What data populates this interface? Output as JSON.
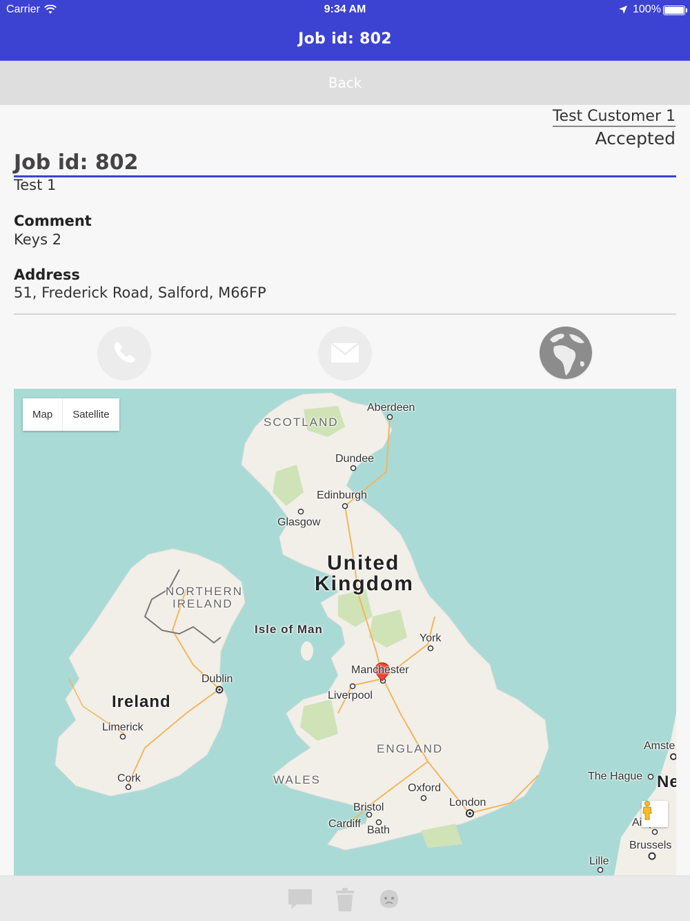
{
  "status_bar": {
    "carrier": "Carrier",
    "time": "9:34 AM",
    "battery": "100%"
  },
  "nav": {
    "title": "Job id: 802"
  },
  "back_label": "Back",
  "job": {
    "customer": "Test Customer 1",
    "status": "Accepted",
    "title": "Job id: 802",
    "description": "Test 1",
    "comment_label": "Comment",
    "comment": "Keys 2",
    "address_label": "Address",
    "address": "51, Frederick Road, Salford, M66FP"
  },
  "actions": [
    {
      "name": "phone-icon"
    },
    {
      "name": "email-icon"
    },
    {
      "name": "globe-icon"
    }
  ],
  "map": {
    "type_buttons": [
      "Map",
      "Satellite"
    ],
    "labels": {
      "aberdeen": "Aberdeen",
      "scotland": "SCOTLAND",
      "dundee": "Dundee",
      "edinburgh": "Edinburgh",
      "glasgow": "Glasgow",
      "uk_line1": "United",
      "uk_line2": "Kingdom",
      "ni_line1": "NORTHERN",
      "ni_line2": "IRELAND",
      "isle_of_man": "Isle of Man",
      "york": "York",
      "manchester": "Manchester",
      "liverpool": "Liverpool",
      "dublin": "Dublin",
      "ireland": "Ireland",
      "limerick": "Limerick",
      "cork": "Cork",
      "england": "ENGLAND",
      "wales": "WALES",
      "oxford": "Oxford",
      "bristol": "Bristol",
      "london": "London",
      "cardiff": "Cardiff",
      "bath": "Bath",
      "amsterdam": "Amste",
      "the_hague": "The Hague",
      "netherlands": "Ne",
      "antwerp": "Ai    rp",
      "brussels": "Brussels",
      "lille": "Lille"
    }
  },
  "colors": {
    "primary": "#3c43d2",
    "water": "#aadad6",
    "land": "#f2efe9"
  }
}
